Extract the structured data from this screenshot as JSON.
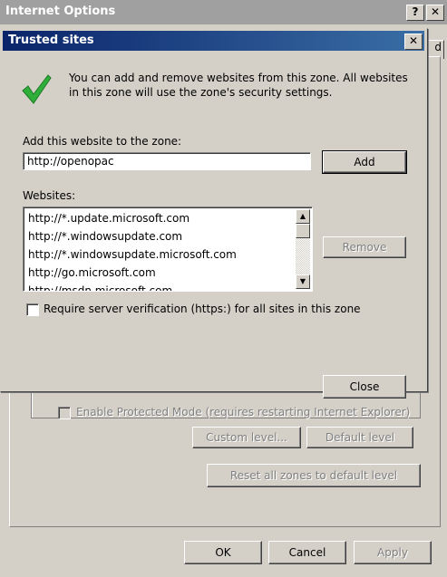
{
  "internet_options": {
    "title": "Internet Options",
    "help_glyph": "?",
    "close_glyph": "✕",
    "tab_peek": "d",
    "enable_protected_mode_label": "Enable Protected Mode (requires restarting Internet Explorer)",
    "custom_level_label": "Custom level...",
    "default_level_label": "Default level",
    "reset_all_label": "Reset all zones to default level",
    "ok_label": "OK",
    "cancel_label": "Cancel",
    "apply_label": "Apply"
  },
  "trusted_sites": {
    "title": "Trusted sites",
    "close_glyph": "✕",
    "info_text": "You can add and remove websites from this zone. All websites in this zone will use the zone's security settings.",
    "add_label": "Add this website to the zone:",
    "add_value": "http://openopac",
    "add_button": "Add",
    "websites_label": "Websites:",
    "websites": [
      "http://*.update.microsoft.com",
      "http://*.windowsupdate.com",
      "http://*.windowsupdate.microsoft.com",
      "http://go.microsoft.com",
      "http://msdn.microsoft.com"
    ],
    "remove_button": "Remove",
    "require_verification_label": "Require server verification (https:) for all sites in this zone",
    "require_verification_checked": false,
    "close_button": "Close"
  },
  "icons": {
    "check": "checkmark-icon",
    "scroll_up": "scroll-up-icon",
    "scroll_down": "scroll-down-icon"
  }
}
